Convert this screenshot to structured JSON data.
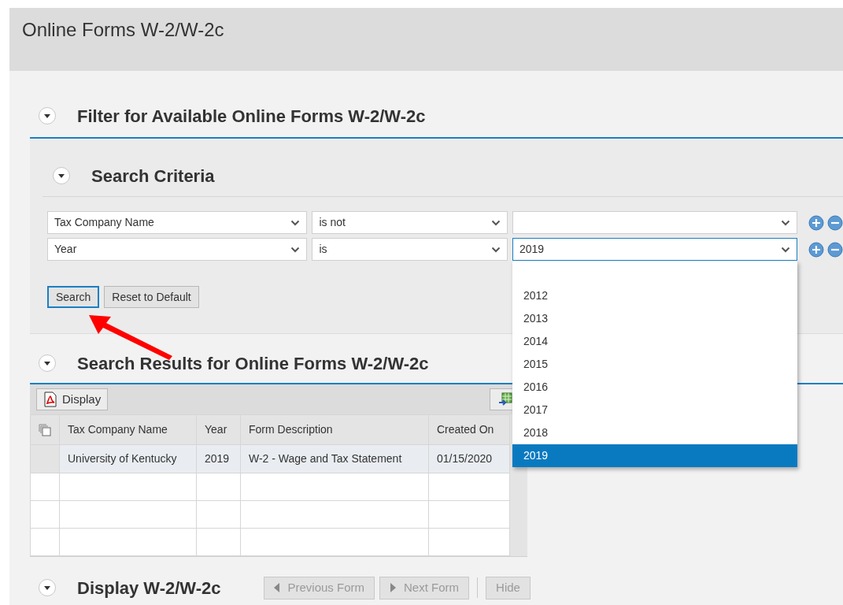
{
  "page_title": "Online Forms W-2/W-2c",
  "filter_section": {
    "title": "Filter for Available Online Forms W-2/W-2c",
    "expanded": true
  },
  "search_criteria": {
    "title": "Search Criteria",
    "expanded": true,
    "rows": [
      {
        "field": "Tax Company Name",
        "operator": "is not",
        "focused": false
      },
      {
        "field": "Year",
        "operator": "is",
        "value": "2019",
        "focused": true
      }
    ],
    "buttons": [
      {
        "label": "Search",
        "focused": true
      },
      {
        "label": "Reset to Default",
        "focused": false
      }
    ]
  },
  "year_dropdown": {
    "options": [
      {
        "label": "2012",
        "selected": false
      },
      {
        "label": "2013",
        "selected": false
      },
      {
        "label": "2014",
        "selected": false
      },
      {
        "label": "2015",
        "selected": false
      },
      {
        "label": "2016",
        "selected": false
      },
      {
        "label": "2017",
        "selected": false
      },
      {
        "label": "2018",
        "selected": false
      },
      {
        "label": "2019",
        "selected": true
      }
    ]
  },
  "results_section": {
    "title": "Search Results for Online Forms W-2/W-2c",
    "expanded": true,
    "display_button": "Display",
    "columns": [
      "Tax Company Name",
      "Year",
      "Form Description",
      "Created On"
    ],
    "rows": [
      [
        "University of Kentucky",
        "2019",
        "W-2 - Wage and Tax Statement",
        "01/15/2020"
      ]
    ]
  },
  "display_section": {
    "title": "Display W-2/W-2c",
    "expanded": true,
    "buttons": [
      {
        "label": "Previous Form",
        "kind": "previous",
        "disabled": true
      },
      {
        "label": "Next Form",
        "kind": "next",
        "disabled": true
      },
      {
        "label": "Hide",
        "kind": "plain",
        "disabled": true
      }
    ]
  }
}
